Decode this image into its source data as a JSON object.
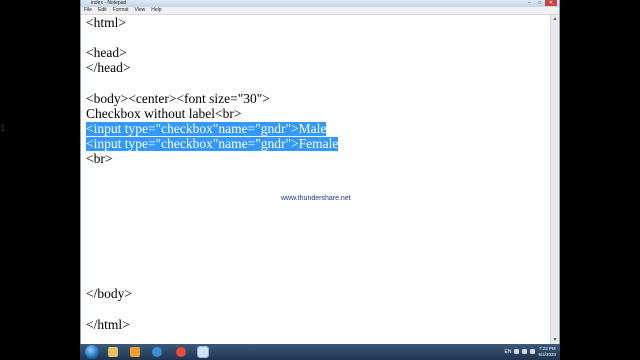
{
  "window": {
    "title": "index - Notepad",
    "controls": {
      "minimize": "–",
      "maximize": "□",
      "close": "✕"
    }
  },
  "menu": [
    "File",
    "Edit",
    "Format",
    "View",
    "Help"
  ],
  "editor": {
    "lines": [
      "<html>",
      "",
      "<head>",
      "</head>",
      "",
      "<body><center><font size=\"30\">",
      "Checkbox without label<br>",
      "<input type=\"checkbox\"name=\"gndr\">Male",
      "<input type=\"checkbox\"name=\"gndr\">Female",
      "<br>",
      "</body>",
      "</html>"
    ],
    "cursor_glyph": "I"
  },
  "watermark": "www.thundershare.net",
  "scrollbar": {
    "up": "▲",
    "down": "▼"
  },
  "taskbar": {
    "icons": [
      "start-orb",
      "file-explorer",
      "media-player",
      "internet-explorer",
      "chrome",
      "notepad"
    ],
    "icon_colors": [
      "#1c6fb8",
      "#e9c15a",
      "#f0a030",
      "#3a8fd8",
      "#e84c3d",
      "#cfe3f5"
    ],
    "language": "EN",
    "time": "7:23 PM",
    "date": "6/4/2020"
  }
}
